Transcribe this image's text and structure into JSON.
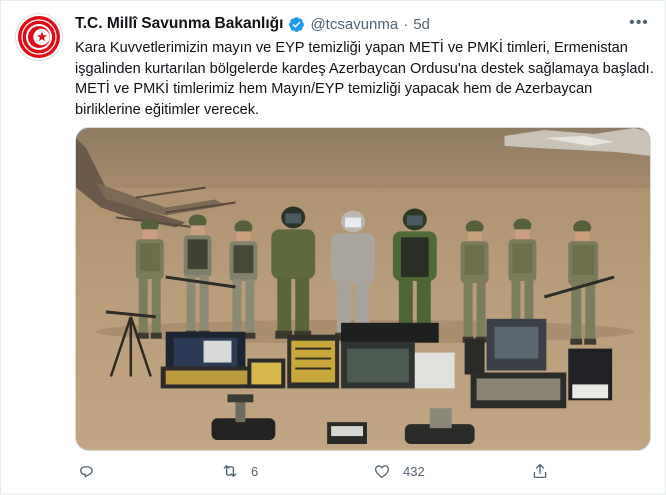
{
  "tweet": {
    "display_name": "T.C. Millî Savunma Bakanlığı",
    "handle": "@tcsavunma",
    "separator": "·",
    "time": "5d",
    "more_icon": "more-dots-icon",
    "text": "Kara Kuvvetlerimizin mayın ve EYP temizliği yapan METİ ve PMKİ timleri, Ermenistan işgalinden kurtarılan bölgelerde kardeş Azerbaycan Ordusu'na destek sağlamaya başladı. METİ ve PMKİ timlerimiz hem Mayın/EYP temizliği yapacak hem de Azerbaycan birliklerine eğitimler verecek."
  },
  "actions": {
    "reply": {
      "icon": "reply-icon",
      "count": ""
    },
    "retweet": {
      "icon": "retweet-icon",
      "count": "6"
    },
    "like": {
      "icon": "heart-icon",
      "count": "432"
    },
    "share": {
      "icon": "share-icon",
      "count": ""
    }
  },
  "colors": {
    "verified": "#1d9bf0",
    "secondary_text": "#536471",
    "avatar_red": "#e30a17"
  }
}
